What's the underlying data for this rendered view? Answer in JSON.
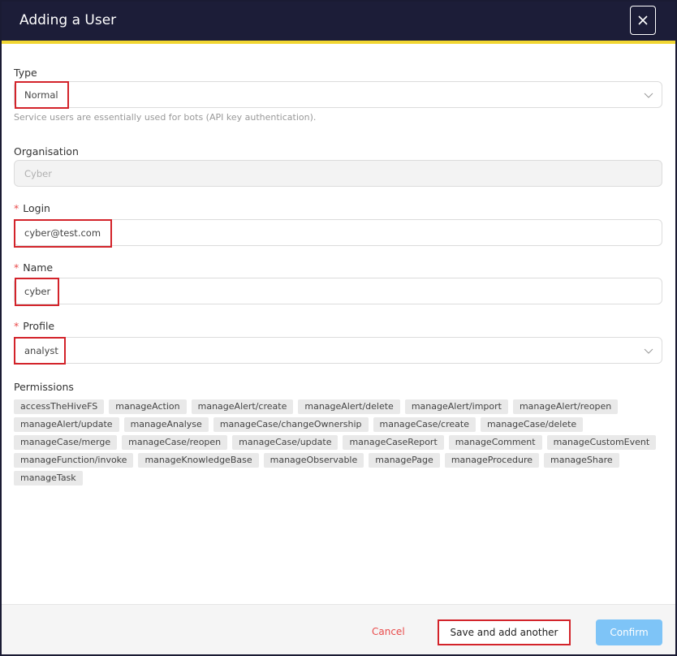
{
  "dialog": {
    "title": "Adding a User"
  },
  "form": {
    "type": {
      "label": "Type",
      "value": "Normal",
      "help": "Service users are essentially used for bots (API key authentication)."
    },
    "organisation": {
      "label": "Organisation",
      "value": "Cyber"
    },
    "login": {
      "label": "Login",
      "required_mark": "*",
      "value": "cyber@test.com"
    },
    "name": {
      "label": "Name",
      "required_mark": "*",
      "value": "cyber"
    },
    "profile": {
      "label": "Profile",
      "required_mark": "*",
      "value": "analyst"
    },
    "permissions": {
      "label": "Permissions",
      "items": [
        "accessTheHiveFS",
        "manageAction",
        "manageAlert/create",
        "manageAlert/delete",
        "manageAlert/import",
        "manageAlert/reopen",
        "manageAlert/update",
        "manageAnalyse",
        "manageCase/changeOwnership",
        "manageCase/create",
        "manageCase/delete",
        "manageCase/merge",
        "manageCase/reopen",
        "manageCase/update",
        "manageCaseReport",
        "manageComment",
        "manageCustomEvent",
        "manageFunction/invoke",
        "manageKnowledgeBase",
        "manageObservable",
        "managePage",
        "manageProcedure",
        "manageShare",
        "manageTask"
      ]
    }
  },
  "footer": {
    "cancel_label": "Cancel",
    "save_another_label": "Save and add another",
    "confirm_label": "Confirm"
  },
  "colors": {
    "header_bg": "#1c1d38",
    "header_accent": "#f1d633",
    "required": "#e94b4b",
    "confirm_bg": "#7ec4f7",
    "highlight": "#d3232a"
  },
  "icons": {
    "close": "close-icon",
    "dropdown": "chevron-down-icon"
  }
}
